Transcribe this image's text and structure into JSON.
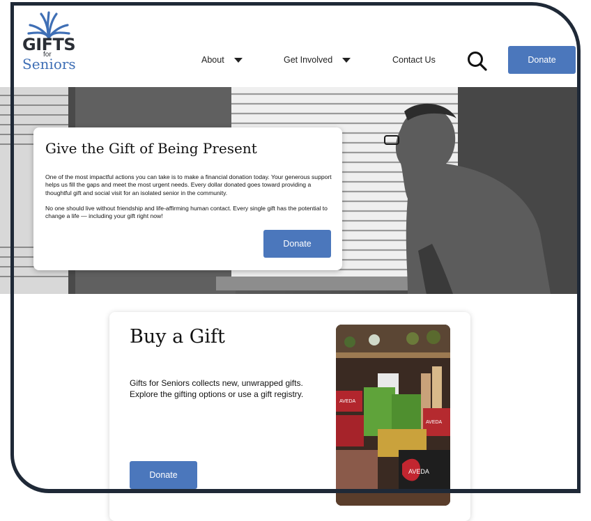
{
  "logo": {
    "line1": "GIFTS",
    "line2": "for",
    "line3": "Seniors",
    "icon": "flower-icon",
    "accent": "#3f6fb5"
  },
  "nav": {
    "about": "About",
    "get_involved": "Get Involved",
    "contact": "Contact Us",
    "search_icon": "search-icon",
    "donate": "Donate"
  },
  "hero": {
    "title": "Give the Gift of Being Present",
    "paragraph1": "One of the most impactful actions you can take is to make a financial donation today. Your generous support helps us fill the gaps and meet the most urgent needs.  Every dollar donated goes toward providing a thoughtful gift and social visit for an isolated senior in the community.",
    "paragraph2": "No one should live without friendship and life-affirming human contact. Every single gift has the potential to change a life — including your gift right now!",
    "donate": "Donate"
  },
  "gift": {
    "title": "Buy a Gift",
    "body": "Gifts for Seniors collects new, unwrapped gifts. Explore the gifting options or use a gift registry.",
    "donate": "Donate",
    "bag_label_1": "AVEDA",
    "bag_label_2": "AVEDA",
    "bag_label_3": "AVEDA"
  },
  "colors": {
    "brand_blue": "#4b77bc",
    "frame": "#1f2937"
  }
}
